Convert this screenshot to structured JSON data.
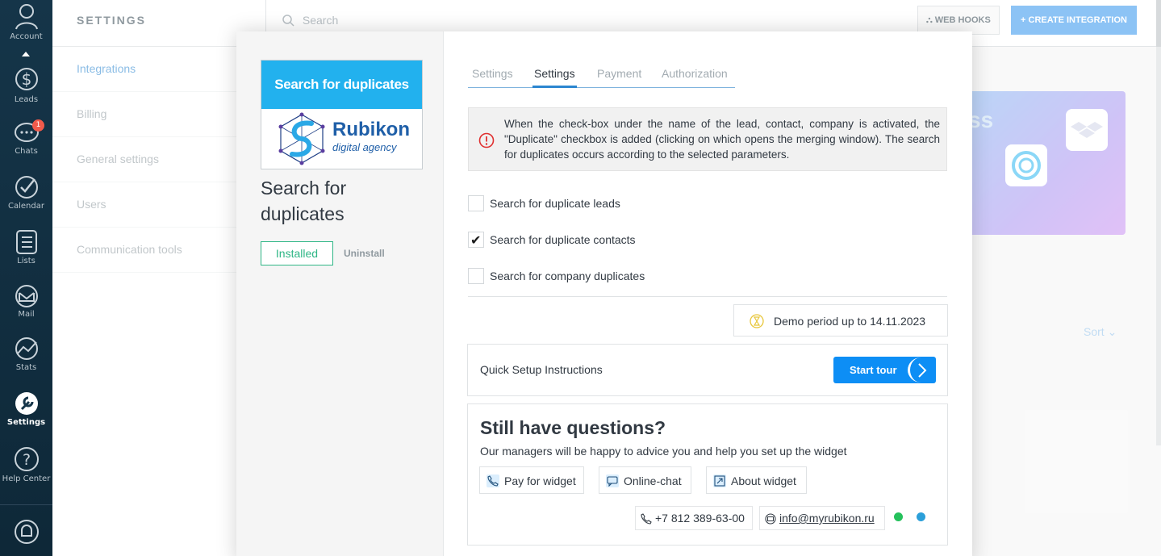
{
  "nav": {
    "items": [
      {
        "label": "Account"
      },
      {
        "label": "Leads"
      },
      {
        "label": "Chats",
        "badge": "1"
      },
      {
        "label": "Calendar"
      },
      {
        "label": "Lists"
      },
      {
        "label": "Mail"
      },
      {
        "label": "Stats"
      },
      {
        "label": "Settings"
      },
      {
        "label": "Help Center"
      }
    ]
  },
  "settings": {
    "title": "SETTINGS",
    "links": [
      "Integrations",
      "Billing",
      "General settings",
      "Users",
      "Communication tools"
    ]
  },
  "topbar": {
    "search_placeholder": "Search",
    "webhooks": "WEB HOOKS",
    "create": "+ CREATE INTEGRATION"
  },
  "background": {
    "banner_text": "ss",
    "sort": "Sort"
  },
  "widget": {
    "logo_banner": "Search for duplicates",
    "logo_word": "Rubikon",
    "logo_sub": "digital agency",
    "name": "Search for duplicates",
    "installed": "Installed",
    "uninstall": "Uninstall"
  },
  "tabs": [
    "Settings",
    "Settings",
    "Payment",
    "Authorization"
  ],
  "notice": "When the check-box under the name of the lead, contact, company is activated, the \"Duplicate\" checkbox is added (clicking on which opens the merging window). The search for duplicates occurs according to the selected parameters.",
  "options": [
    {
      "label": "Search for duplicate leads",
      "checked": false
    },
    {
      "label": "Search for duplicate contacts",
      "checked": true
    },
    {
      "label": "Search for company duplicates",
      "checked": false
    }
  ],
  "demo": "Demo period up to 14.11.2023",
  "quick": {
    "text": "Quick Setup Instructions",
    "button": "Start tour"
  },
  "questions": {
    "title": "Still have questions?",
    "subtitle": "Our managers will be happy to advice you and help you set up the widget",
    "buttons": [
      "Pay for widget",
      "Online-chat",
      "About widget"
    ],
    "phone": "+7 812 389-63-00",
    "email": "info@myrubikon.ru"
  },
  "colors": {
    "accent": "#2b86d0",
    "installed": "#2fb686",
    "tour": "#0d8ef5",
    "nav_bg": "#153549"
  }
}
